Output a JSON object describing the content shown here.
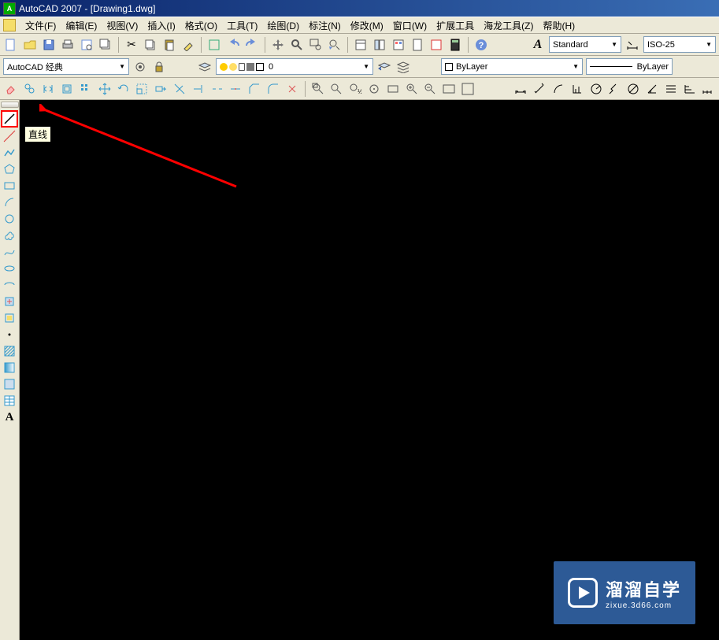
{
  "title": "AutoCAD 2007 - [Drawing1.dwg]",
  "menu": [
    {
      "label": "文件",
      "accel": "(F)"
    },
    {
      "label": "编辑",
      "accel": "(E)"
    },
    {
      "label": "视图",
      "accel": "(V)"
    },
    {
      "label": "插入",
      "accel": "(I)"
    },
    {
      "label": "格式",
      "accel": "(O)"
    },
    {
      "label": "工具",
      "accel": "(T)"
    },
    {
      "label": "绘图",
      "accel": "(D)"
    },
    {
      "label": "标注",
      "accel": "(N)"
    },
    {
      "label": "修改",
      "accel": "(M)"
    },
    {
      "label": "窗口",
      "accel": "(W)"
    },
    {
      "label": "扩展工具",
      "accel": ""
    },
    {
      "label": "海龙工具",
      "accel": "(Z)"
    },
    {
      "label": "帮助",
      "accel": "(H)"
    }
  ],
  "std_toolbar": {
    "icons": [
      "new",
      "open",
      "save",
      "plot",
      "plot-preview",
      "publish",
      "sep",
      "cut",
      "copy",
      "paste",
      "sep",
      "match-prop",
      "block-editor",
      "sep",
      "undo",
      "redo",
      "sep",
      "pan",
      "zoom-realtime",
      "zoom-prev",
      "zoom-window",
      "zoom",
      "sep",
      "properties",
      "design-center",
      "tool-palettes",
      "sheet-set",
      "markup",
      "calc",
      "sep",
      "help"
    ]
  },
  "styles": {
    "text_style": "Standard",
    "dim_style": "ISO-25"
  },
  "workspace": {
    "name": "AutoCAD 经典",
    "settings_icon": "workspace-settings-icon",
    "lock_icon": "toolbar-lock-icon"
  },
  "layers": {
    "current": "0",
    "prev_icon": "layer-previous-icon",
    "manager_icon": "layer-properties-icon"
  },
  "properties": {
    "color": "ByLayer",
    "lineweight": "ByLayer"
  },
  "draw_tools": [
    {
      "name": "line",
      "tooltip": "直线",
      "highlight": true
    },
    {
      "name": "construction-line"
    },
    {
      "name": "polyline"
    },
    {
      "name": "polygon"
    },
    {
      "name": "rectangle"
    },
    {
      "name": "arc"
    },
    {
      "name": "circle"
    },
    {
      "name": "revision-cloud"
    },
    {
      "name": "spline"
    },
    {
      "name": "ellipse"
    },
    {
      "name": "ellipse-arc"
    },
    {
      "name": "insert-block"
    },
    {
      "name": "make-block"
    },
    {
      "name": "point"
    },
    {
      "name": "hatch"
    },
    {
      "name": "gradient"
    },
    {
      "name": "region"
    },
    {
      "name": "table"
    },
    {
      "name": "mtext"
    }
  ],
  "tooltip": "直线",
  "watermark": {
    "main": "溜溜自学",
    "sub": "zixue.3d66.com"
  },
  "dim_icons": [
    "linear",
    "aligned",
    "arc-length",
    "ordinate",
    "radius",
    "jogged",
    "diameter",
    "angular",
    "quick-dim",
    "baseline",
    "continue"
  ]
}
